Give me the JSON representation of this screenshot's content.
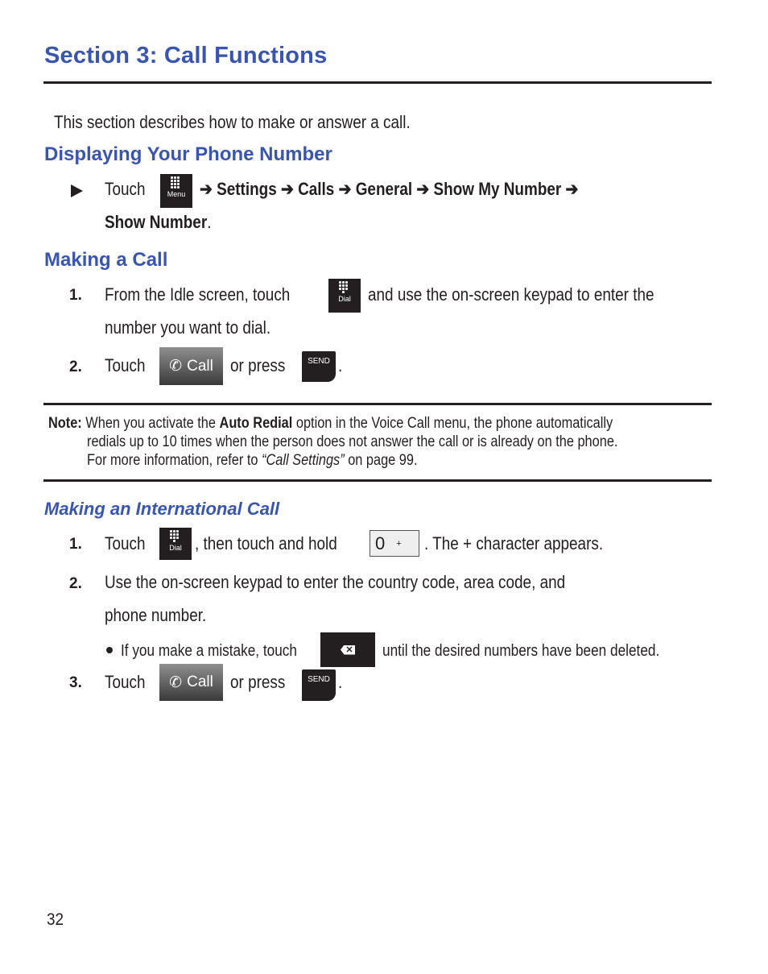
{
  "page": {
    "title": "Section 3: Call Functions",
    "intro": "This section describes how to make or answer a call.",
    "page_number": "32"
  },
  "displaying": {
    "heading": "Displaying Your Phone Number",
    "touch": "Touch",
    "menu_icon_label": "Menu",
    "path": "➔ Settings ➔ Calls ➔ General ➔ Show My Number ➔",
    "final": "Show Number",
    "period": "."
  },
  "making": {
    "heading": "Making a Call",
    "step1_num": "1.",
    "step1_a": "From the Idle screen, touch",
    "dial_icon_label": "Dial",
    "step1_b": "and use the on-screen keypad to enter the",
    "step1_c": "number you want to dial.",
    "step2_num": "2.",
    "step2_a": "Touch",
    "call_label": "Call",
    "step2_b": "or press",
    "send_label": "SEND",
    "period": "."
  },
  "note": {
    "label": "Note:",
    "line1_a": "When you activate the",
    "line1_bold": "Auto Redial",
    "line1_b": "option in the Voice Call menu, the phone automatically",
    "line2": "redials up to 10 times when the person does not answer the call or is already on the phone.",
    "line3_a": "For more information, refer to",
    "line3_italic": "“Call Settings”",
    "line3_b": "on page 99."
  },
  "international": {
    "heading": "Making an International Call",
    "step1_num": "1.",
    "step1_a": "Touch",
    "dial_icon_label": "Dial",
    "step1_b": ", then touch and hold",
    "zero_key": "0",
    "plus_key": "+",
    "step1_c": ". The + character appears.",
    "step2_num": "2.",
    "step2_a": "Use the on-screen keypad to enter the country code, area code, and",
    "step2_b": "phone number.",
    "bullet_a": "If you make a mistake, touch",
    "bullet_b": "until the desired numbers have been deleted.",
    "step3_num": "3.",
    "step3_a": "Touch",
    "call_label": "Call",
    "step3_b": "or press",
    "send_label": "SEND",
    "period": "."
  }
}
